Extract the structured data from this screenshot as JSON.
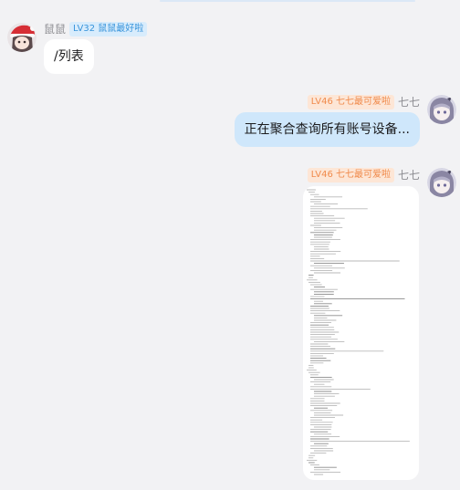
{
  "messages": [
    {
      "side": "left",
      "sender": "鼠鼠",
      "badge": "LV32 鼠鼠最好啦",
      "text": "/列表",
      "avatar_icon": "girl-santa-hat-avatar"
    },
    {
      "side": "right",
      "sender": "七七",
      "badge": "LV46 七七最可爱啦",
      "text": "正在聚合查询所有账号设备...",
      "avatar_icon": "silver-hair-girl-avatar"
    },
    {
      "side": "right",
      "sender": "七七",
      "badge": "LV46 七七最可爱啦",
      "image": "json-text-screenshot",
      "avatar_icon": "silver-hair-girl-avatar"
    }
  ],
  "colors": {
    "background": "#f2f2f4",
    "bubble_left": "#ffffff",
    "bubble_right": "#cfe7fb",
    "badge_blue_bg": "#d8ecfc",
    "badge_blue_text": "#3a95db",
    "badge_orange_bg": "#fde6d6",
    "badge_orange_text": "#f08a4b"
  }
}
